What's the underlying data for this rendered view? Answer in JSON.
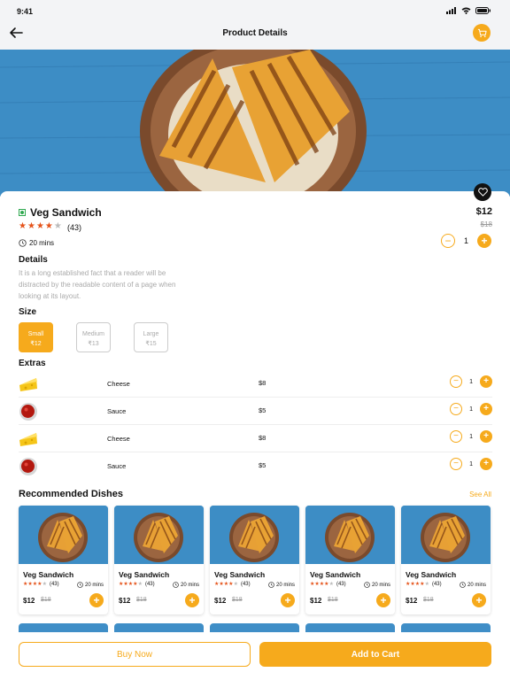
{
  "status_bar": {
    "time": "9:41"
  },
  "header": {
    "title": "Product Details",
    "back_icon": "arrow-left-icon",
    "cart_icon": "cart-icon"
  },
  "product": {
    "name": "Veg Sandwich",
    "rating": 4,
    "rating_count": "(43)",
    "time": "20 mins",
    "price": "$12",
    "old_price": "$18",
    "quantity": "1"
  },
  "details": {
    "heading": "Details",
    "text": "It is a long established fact that a reader will be distracted by the readable content of a page when looking at its layout."
  },
  "size": {
    "heading": "Size",
    "options": [
      {
        "label": "Small",
        "price": "₹12",
        "selected": true
      },
      {
        "label": "Medium",
        "price": "₹13",
        "selected": false
      },
      {
        "label": "Large",
        "price": "₹15",
        "selected": false
      }
    ]
  },
  "extras": {
    "heading": "Extras",
    "items": [
      {
        "name": "Cheese",
        "price": "$8",
        "qty": "1",
        "icon": "cheese-icon"
      },
      {
        "name": "Sauce",
        "price": "$5",
        "qty": "1",
        "icon": "sauce-icon"
      },
      {
        "name": "Cheese",
        "price": "$8",
        "qty": "1",
        "icon": "cheese-icon"
      },
      {
        "name": "Sauce",
        "price": "$5",
        "qty": "1",
        "icon": "sauce-icon"
      }
    ]
  },
  "recommended": {
    "heading": "Recommended Dishes",
    "see_all": "See All",
    "items": [
      {
        "name": "Veg Sandwich",
        "rating_count": "(43)",
        "time": "20 mins",
        "price": "$12",
        "old_price": "$18"
      },
      {
        "name": "Veg Sandwich",
        "rating_count": "(43)",
        "time": "20 mins",
        "price": "$12",
        "old_price": "$18"
      },
      {
        "name": "Veg Sandwich",
        "rating_count": "(43)",
        "time": "20 mins",
        "price": "$12",
        "old_price": "$18"
      },
      {
        "name": "Veg Sandwich",
        "rating_count": "(43)",
        "time": "20 mins",
        "price": "$12",
        "old_price": "$18"
      },
      {
        "name": "Veg Sandwich",
        "rating_count": "(43)",
        "time": "20 mins",
        "price": "$12",
        "old_price": "$18"
      }
    ]
  },
  "actions": {
    "buy_now": "Buy Now",
    "add_to_cart": "Add to Cart"
  },
  "colors": {
    "accent": "#f6aa1c",
    "star": "#e5531a",
    "veg": "#2fa84f"
  }
}
